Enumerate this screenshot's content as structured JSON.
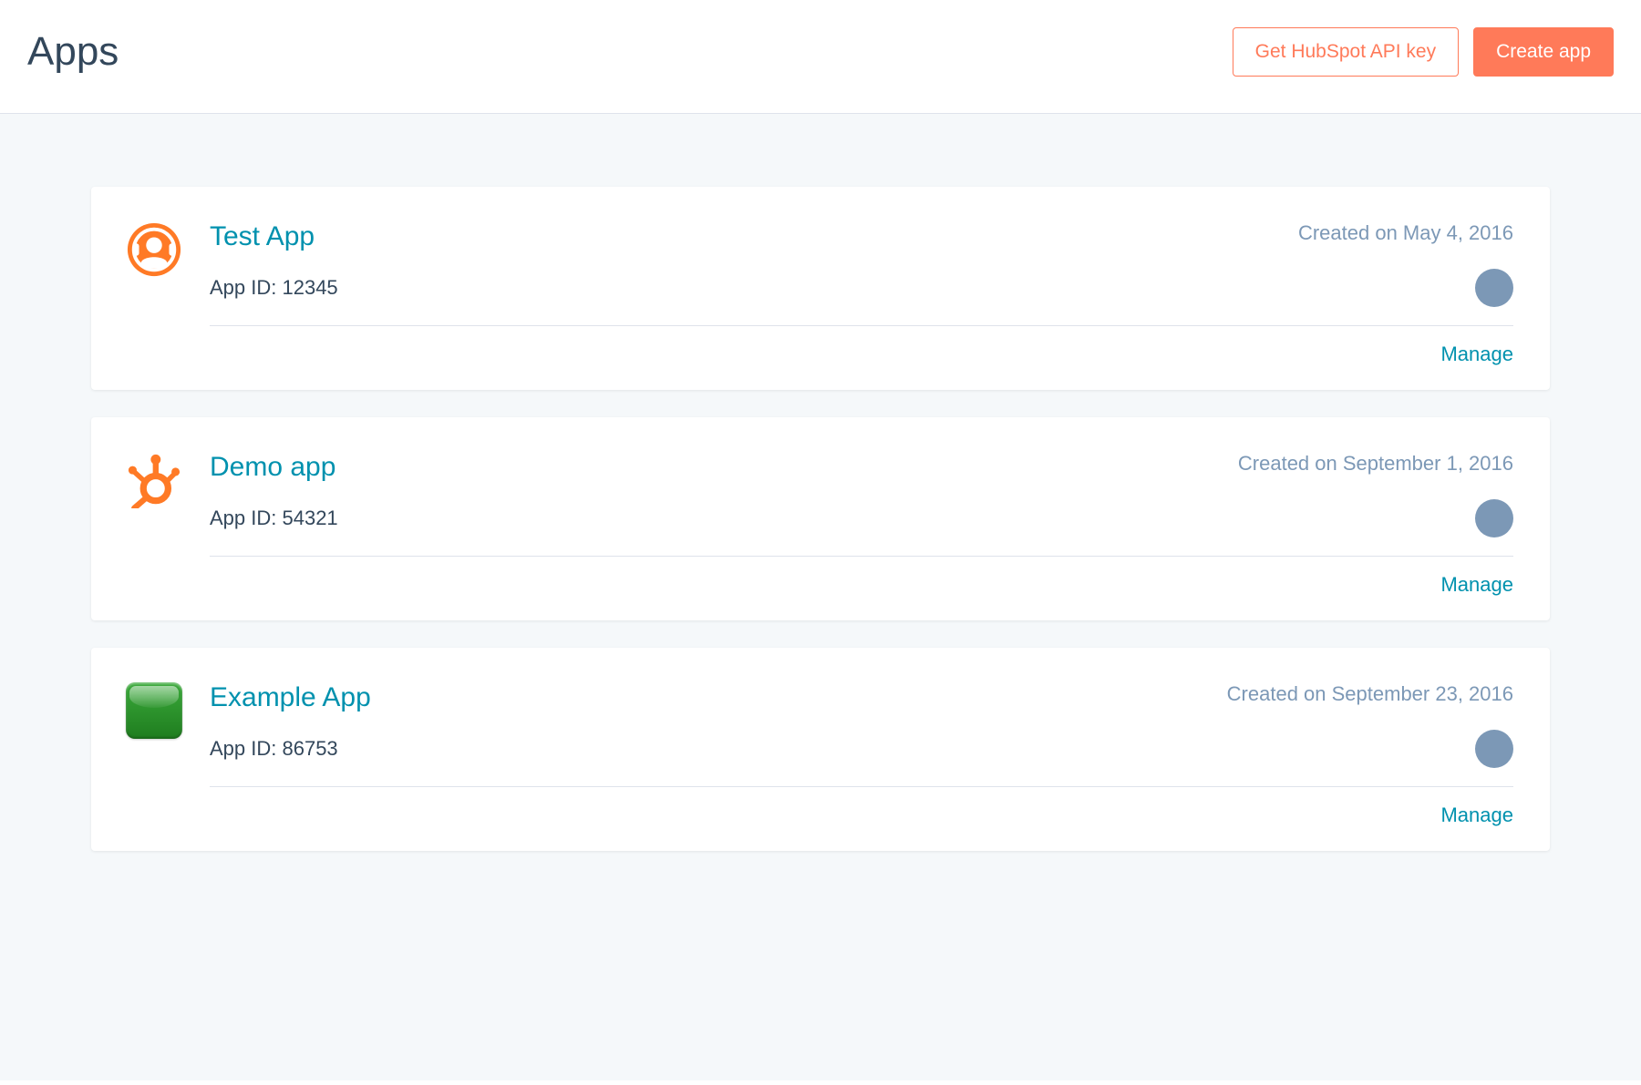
{
  "header": {
    "title": "Apps",
    "api_key_button": "Get HubSpot API key",
    "create_button": "Create app"
  },
  "app_id_label": "App ID: ",
  "created_prefix": "Created on ",
  "manage_label": "Manage",
  "apps": [
    {
      "icon": "support-icon",
      "name": "Test App",
      "app_id": "12345",
      "created": "May 4, 2016"
    },
    {
      "icon": "sprocket-icon",
      "name": "Demo app",
      "app_id": "54321",
      "created": "September 1, 2016"
    },
    {
      "icon": "green-square-icon",
      "name": "Example App",
      "app_id": "86753",
      "created": "September 23, 2016"
    }
  ]
}
